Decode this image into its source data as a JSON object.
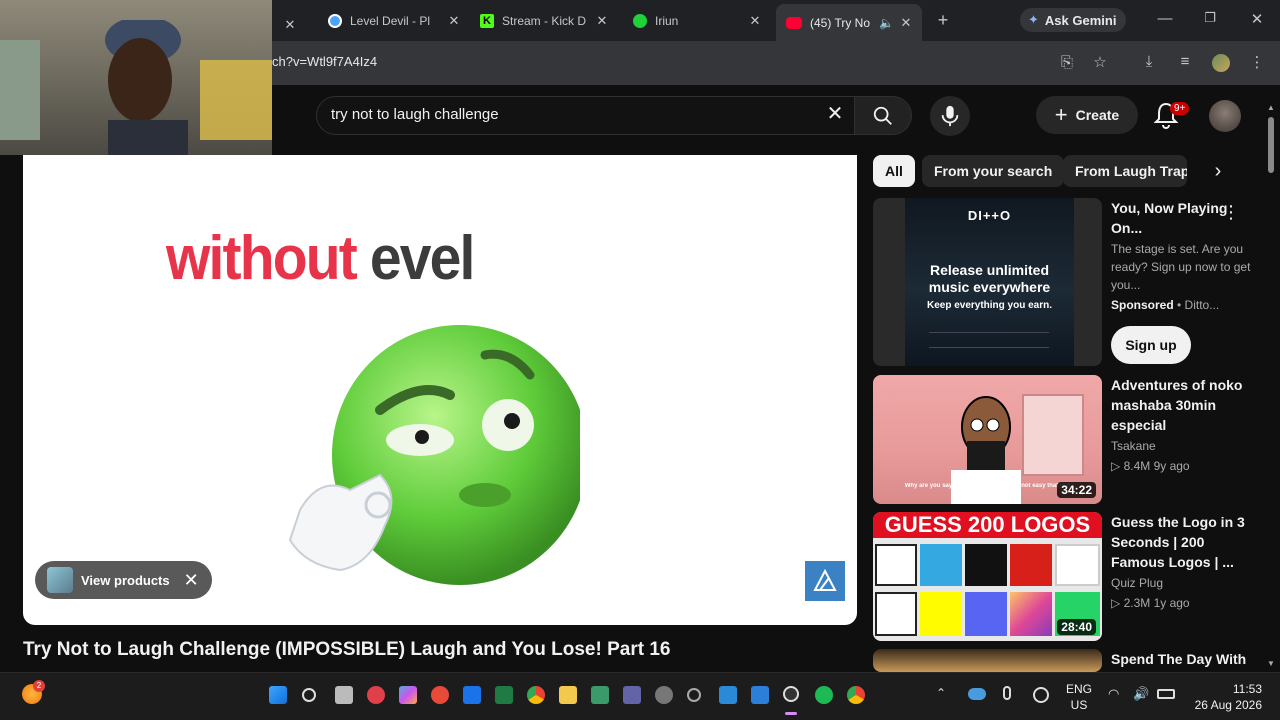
{
  "tabs": [
    {
      "label": "Level Devil - Pl",
      "color": "#4aa3ff"
    },
    {
      "label": "Stream - Kick D",
      "color": "#53fc18"
    },
    {
      "label": "Iriun",
      "color": "#1fd13b"
    },
    {
      "label": "(45) Try No",
      "color": "#ff0033"
    }
  ],
  "gemini_label": "Ask Gemini",
  "url": "ch?v=Wtl9f7A4Iz4",
  "search": {
    "query": "try not to laugh challenge"
  },
  "create_label": "Create",
  "notifications_badge": "9+",
  "video": {
    "caption_word1": "without",
    "caption_word2": "evel",
    "view_products_label": "View products",
    "title": "Try Not to Laugh Challenge (IMPOSSIBLE) Laugh and You Lose! Part 16"
  },
  "chips": [
    "All",
    "From your search",
    "From Laugh Trapp"
  ],
  "recommendations": [
    {
      "title": "You, Now Playing On...",
      "subtitle": "The stage is set. Are you ready? Sign up now to get you...",
      "sponsored": "Sponsored",
      "advertiser": " • Ditto...",
      "cta": "Sign up",
      "thumb_brand": "DI++O",
      "thumb_headline_a": "Release ",
      "thumb_headline_b": "unlimited",
      "thumb_headline_c": "music everywhere",
      "thumb_tagline": "Keep everything you earn."
    },
    {
      "title": "Adventures of noko mashaba 30min especial",
      "channel": "Tsakane",
      "stats": "▷ 8.4M  9y ago",
      "duration": "34:22",
      "thumb_caption": "Why are you saying only be because it's not easy that is it"
    },
    {
      "title": "Guess the Logo in 3 Seconds | 200 Famous Logos | ...",
      "channel": "Quiz Plug",
      "stats": "▷ 2.3M  1y ago",
      "duration": "28:40",
      "thumb_banner": "GUESS 200 LOGOS"
    },
    {
      "title": "Spend The Day With"
    }
  ],
  "taskbar": {
    "lang_top": "ENG",
    "lang_bottom": "US",
    "time": "11:53",
    "date": "26 Aug 2026",
    "weather_badge": "2"
  }
}
